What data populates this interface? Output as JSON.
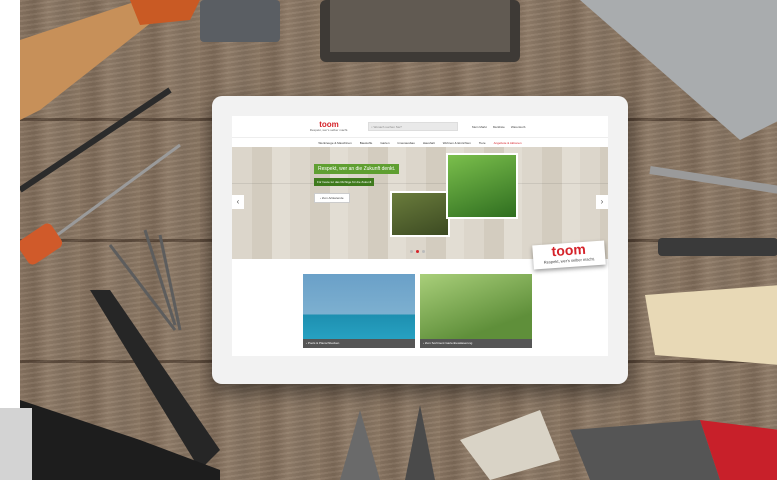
{
  "header": {
    "logo": "toom",
    "logo_tagline": "Respekt, wer's selber macht.",
    "search_placeholder": "Wonach suchen Sie?",
    "links": [
      "Mein Markt",
      "Merkliste",
      "Warenkorb"
    ]
  },
  "nav": {
    "items": [
      "Werkzeuge & Maschinen",
      "Baustoffe",
      "Garten",
      "Innenausbau",
      "Haushalt",
      "Wohnen & Einrichten",
      "Tiere",
      "Angebote & Aktionen"
    ],
    "active_index": 7
  },
  "hero": {
    "title": "Respekt, wer an die Zukunft denkt.",
    "subtitle": "Für heute tut das Richtige für die Zukunft",
    "button": "› Zum Artikelende",
    "prev_arrow": "‹",
    "next_arrow": "›",
    "slide_count": 3,
    "active_slide": 1
  },
  "tiles": [
    {
      "caption": "› Pools & Planschbecken"
    },
    {
      "caption": "› Zum Sortiment Gartenbewässerung"
    }
  ],
  "sticker": {
    "logo": "toom",
    "tagline": "Respekt, wer's selber macht."
  },
  "colors": {
    "brand_red": "#d5232a",
    "hero_green": "#5f9f31",
    "wood": "#8a7663"
  }
}
